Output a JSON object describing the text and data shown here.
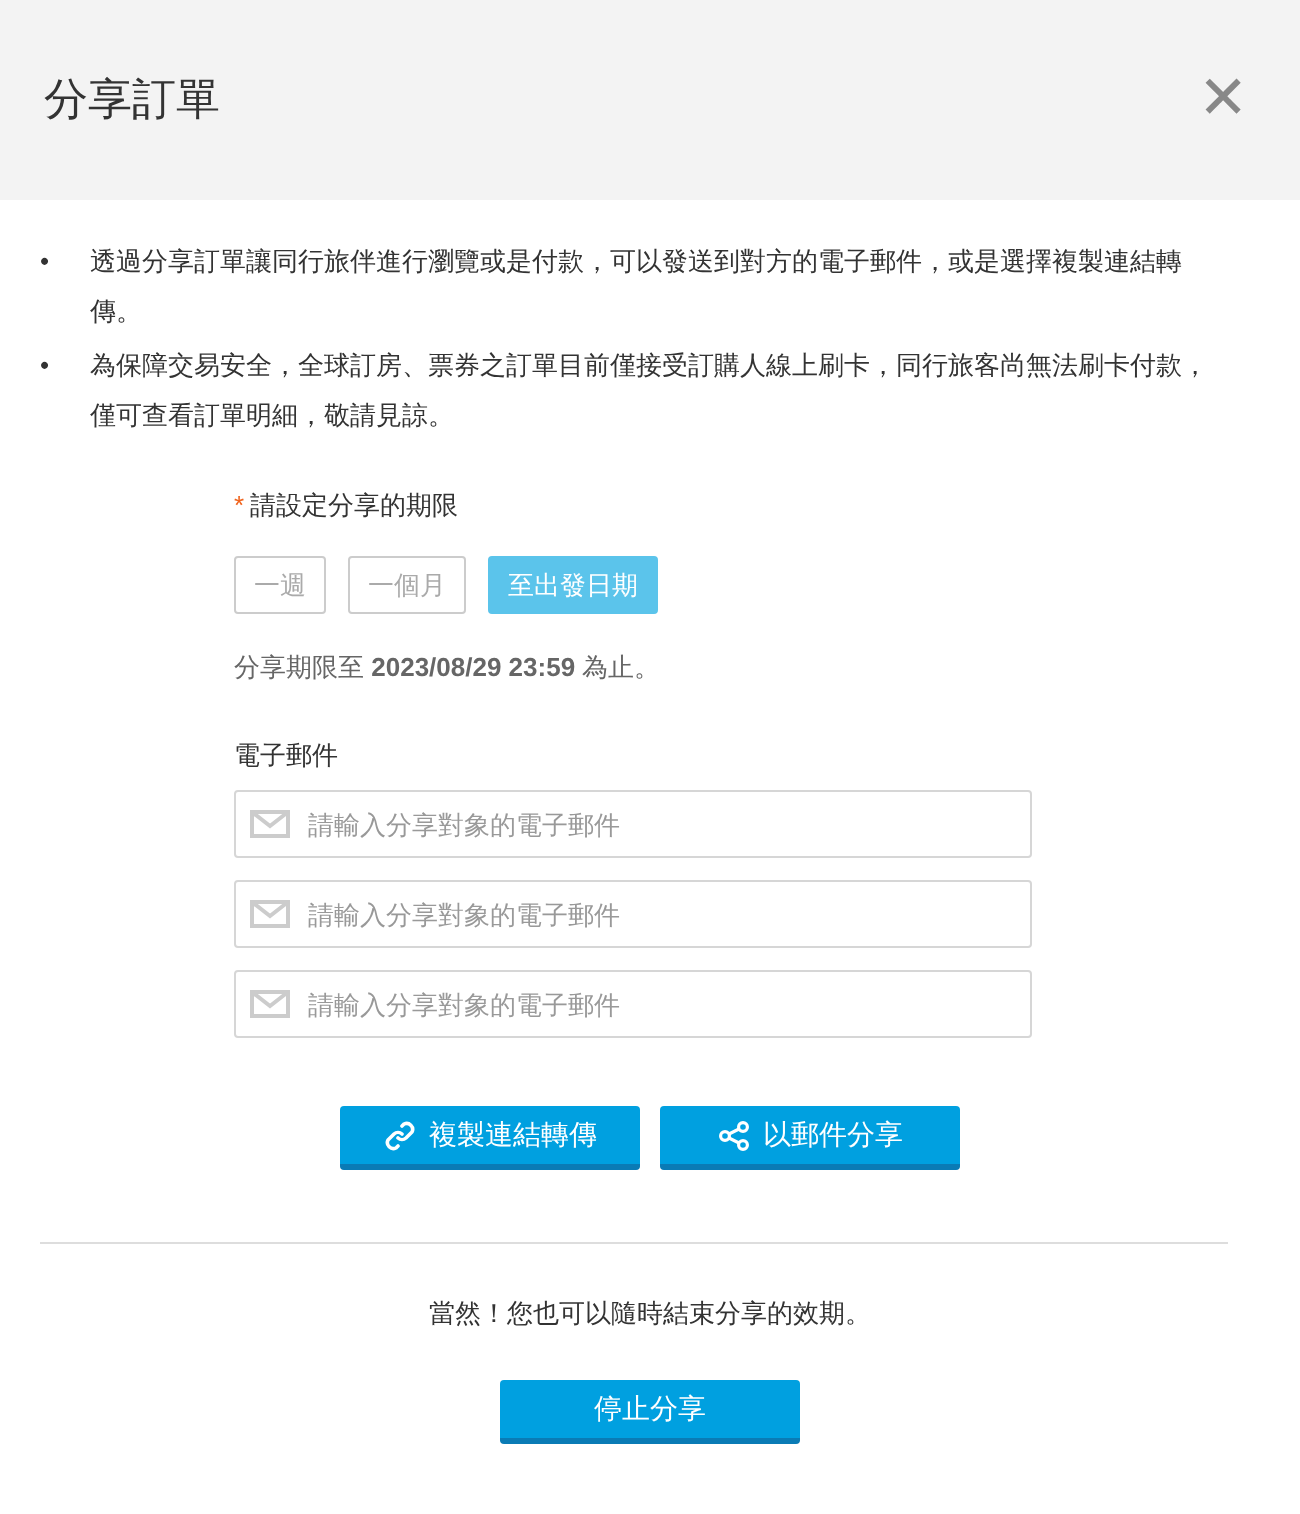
{
  "dialog": {
    "title": "分享訂單",
    "close": "✕"
  },
  "notes": [
    {
      "bullet": "•",
      "text": "透過分享訂單讓同行旅伴進行瀏覽或是付款，可以發送到對方的電子郵件，或是選擇複製連結轉傳。"
    },
    {
      "bullet": "•",
      "text": "為保障交易安全，全球訂房、票券之訂單目前僅接受訂購人線上刷卡，同行旅客尚無法刷卡付款，僅可查看訂單明細，敬請見諒。"
    }
  ],
  "period": {
    "required_mark": "*",
    "label": "請設定分享的期限",
    "options": [
      {
        "label": "一週",
        "selected": false
      },
      {
        "label": "一個月",
        "selected": false
      },
      {
        "label": "至出發日期",
        "selected": true
      }
    ],
    "expiry": "分享期限至 **2023/08/29 23:59** 為止。"
  },
  "email": {
    "label": "電子郵件",
    "fields": [
      {
        "placeholder": "請輸入分享對象的電子郵件"
      },
      {
        "placeholder": "請輸入分享對象的電子郵件"
      },
      {
        "placeholder": "請輸入分享對象的電子郵件"
      }
    ]
  },
  "actions": [
    {
      "kind": "link",
      "label": "複製連結轉傳"
    },
    {
      "kind": "share",
      "label": "以郵件分享"
    }
  ],
  "footer": {
    "note": "當然！您也可以隨時結束分享的效期。",
    "stop_button": "停止分享"
  }
}
